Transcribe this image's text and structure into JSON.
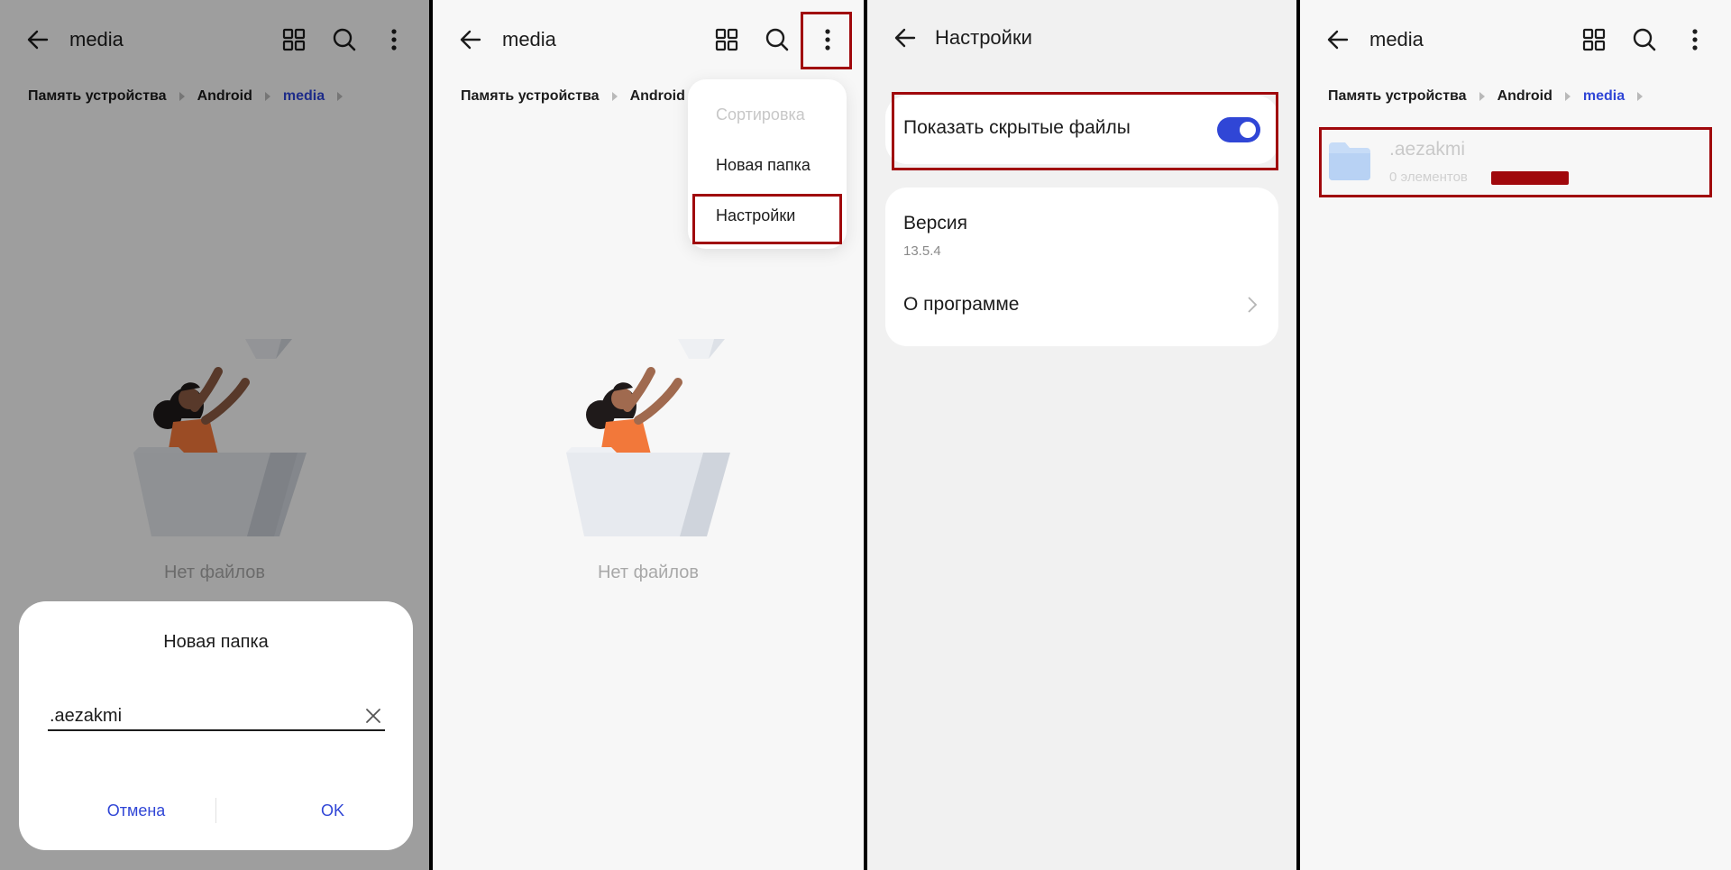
{
  "panels": {
    "p1": {
      "title": "media",
      "breadcrumb": [
        "Память устройства",
        "Android",
        "media"
      ],
      "empty_text": "Нет файлов",
      "dialog": {
        "title": "Новая папка",
        "input_value": ".aezakmi",
        "cancel_label": "Отмена",
        "ok_label": "OK"
      }
    },
    "p2": {
      "title": "media",
      "breadcrumb": [
        "Память устройства",
        "Android"
      ],
      "empty_text": "Нет файлов",
      "menu": [
        "Сортировка",
        "Новая папка",
        "Настройки"
      ]
    },
    "p3": {
      "title": "Настройки",
      "show_hidden_label": "Показать скрытые файлы",
      "show_hidden_enabled": true,
      "version_label": "Версия",
      "version_value": "13.5.4",
      "about_label": "О программе"
    },
    "p4": {
      "title": "media",
      "breadcrumb": [
        "Память устройства",
        "Android",
        "media"
      ],
      "folder": {
        "name": ".aezakmi",
        "meta": "0 элементов"
      }
    }
  },
  "colors": {
    "accent": "#3046d6",
    "highlight": "#a0080c",
    "background": "#f7f7f7",
    "dialog_bg": "#ffffff",
    "folder_blue": "#c7dcf7"
  },
  "icons": [
    "back-arrow-icon",
    "grid-view-icon",
    "search-icon",
    "more-vert-icon",
    "clear-icon",
    "chevron-right-icon",
    "folder-icon"
  ]
}
